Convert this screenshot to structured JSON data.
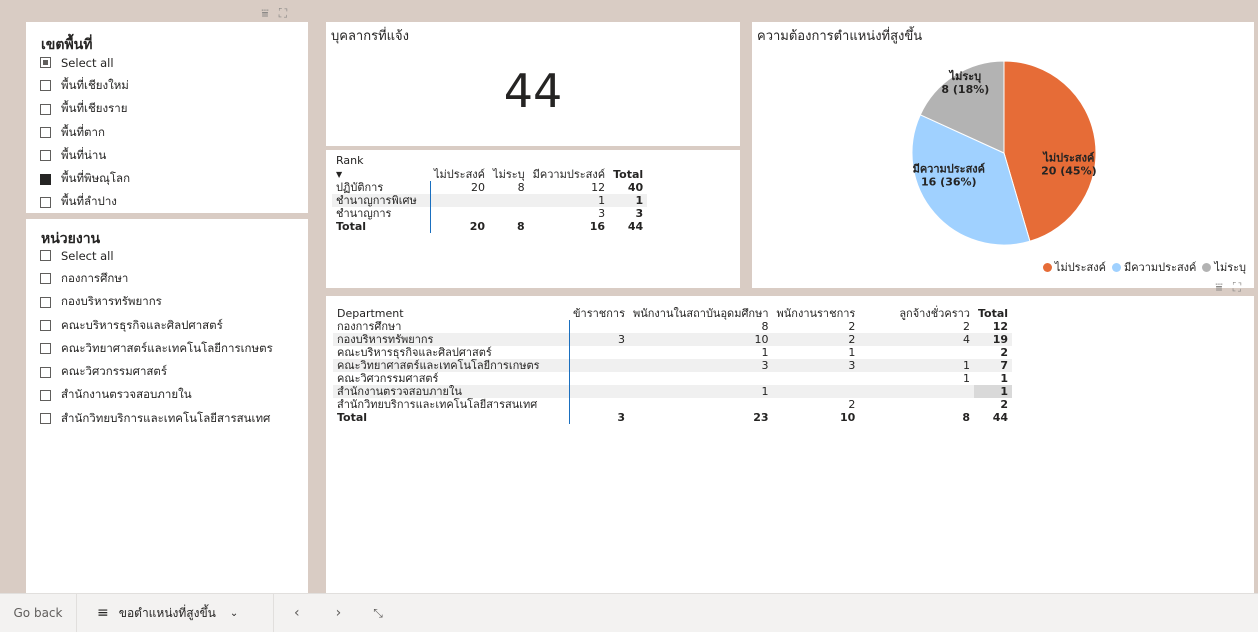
{
  "region_slicer": {
    "title": "เขตพื้นที่",
    "items": [
      {
        "label": "Select all",
        "state": "partial"
      },
      {
        "label": "พื้นที่เชียงใหม่",
        "state": "unchecked"
      },
      {
        "label": "พื้นที่เชียงราย",
        "state": "unchecked"
      },
      {
        "label": "พื้นที่ตาก",
        "state": "unchecked"
      },
      {
        "label": "พื้นที่น่าน",
        "state": "unchecked"
      },
      {
        "label": "พื้นที่พิษณุโลก",
        "state": "checked"
      },
      {
        "label": "พื้นที่ลำปาง",
        "state": "unchecked"
      }
    ]
  },
  "unit_slicer": {
    "title": "หน่วยงาน",
    "items": [
      {
        "label": "Select all",
        "state": "unchecked"
      },
      {
        "label": "กองการศึกษา",
        "state": "unchecked"
      },
      {
        "label": "กองบริหารทรัพยากร",
        "state": "unchecked"
      },
      {
        "label": "คณะบริหารธุรกิจและศิลปศาสตร์",
        "state": "unchecked"
      },
      {
        "label": "คณะวิทยาศาสตร์และเทคโนโลยีการเกษตร",
        "state": "unchecked"
      },
      {
        "label": "คณะวิศวกรรมศาสตร์",
        "state": "unchecked"
      },
      {
        "label": "สำนักงานตรวจสอบภายใน",
        "state": "unchecked"
      },
      {
        "label": "สำนักวิทยบริการและเทคโนโลยีสารสนเทศ",
        "state": "unchecked"
      }
    ]
  },
  "kpi_card": {
    "title": "บุคลากรที่แจ้ง",
    "value": "44"
  },
  "rank_table": {
    "headers": [
      "Rank",
      "ไม่ประสงค์",
      "ไม่ระบุ",
      "มีความประสงค์",
      "Total"
    ],
    "rows": [
      [
        "ปฏิบัติการ",
        "20",
        "8",
        "12",
        "40"
      ],
      [
        "ชำนาญการพิเศษ",
        "",
        "",
        "1",
        "1"
      ],
      [
        "ชำนาญการ",
        "",
        "",
        "3",
        "3"
      ]
    ],
    "total": [
      "Total",
      "20",
      "8",
      "16",
      "44"
    ]
  },
  "pie_card": {
    "title": "ความต้องการตำแหน่งที่สูงขึ้น"
  },
  "chart_data": {
    "type": "pie",
    "title": "ความต้องการตำแหน่งที่สูงขึ้น",
    "slices": [
      {
        "name": "ไม่ประสงค์",
        "value": 20,
        "label": "ไม่ประสงค์",
        "sublabel": "20 (45%)",
        "color": "#e66c37"
      },
      {
        "name": "มีความประสงค์",
        "value": 16,
        "label": "มีความประสงค์",
        "sublabel": "16 (36%)",
        "color": "#a0d1ff"
      },
      {
        "name": "ไม่ระบุ",
        "value": 8,
        "label": "ไม่ระบุ",
        "sublabel": "8 (18%)",
        "color": "#b3b3b3"
      }
    ],
    "legend": [
      "ไม่ประสงค์",
      "มีความประสงค์",
      "ไม่ระบุ"
    ],
    "legend_position": "bottom-right"
  },
  "dept_table": {
    "headers": [
      "Department",
      "ข้าราชการ",
      "พนักงานในสถาบันอุดมศึกษา",
      "พนักงานราชการ",
      "ลูกจ้างชั่วคราว",
      "Total"
    ],
    "rows": [
      [
        "กองการศึกษา",
        "",
        "8",
        "2",
        "2",
        "12"
      ],
      [
        "กองบริหารทรัพยากร",
        "3",
        "10",
        "2",
        "4",
        "19"
      ],
      [
        "คณะบริหารธุรกิจและศิลปศาสตร์",
        "",
        "1",
        "1",
        "",
        "2"
      ],
      [
        "คณะวิทยาศาสตร์และเทคโนโลยีการเกษตร",
        "",
        "3",
        "3",
        "1",
        "7"
      ],
      [
        "คณะวิศวกรรมศาสตร์",
        "",
        "",
        "",
        "1",
        "1"
      ],
      [
        "สำนักงานตรวจสอบภายใน",
        "",
        "1",
        "",
        "",
        "1"
      ],
      [
        "สำนักวิทยบริการและเทคโนโลยีสารสนเทศ",
        "",
        "",
        "2",
        "",
        "2"
      ]
    ],
    "total": [
      "Total",
      "3",
      "23",
      "10",
      "8",
      "44"
    ]
  },
  "taskbar": {
    "go_back": "Go back",
    "page_name": "ขอตำแหน่งที่สูงขึ้น"
  }
}
